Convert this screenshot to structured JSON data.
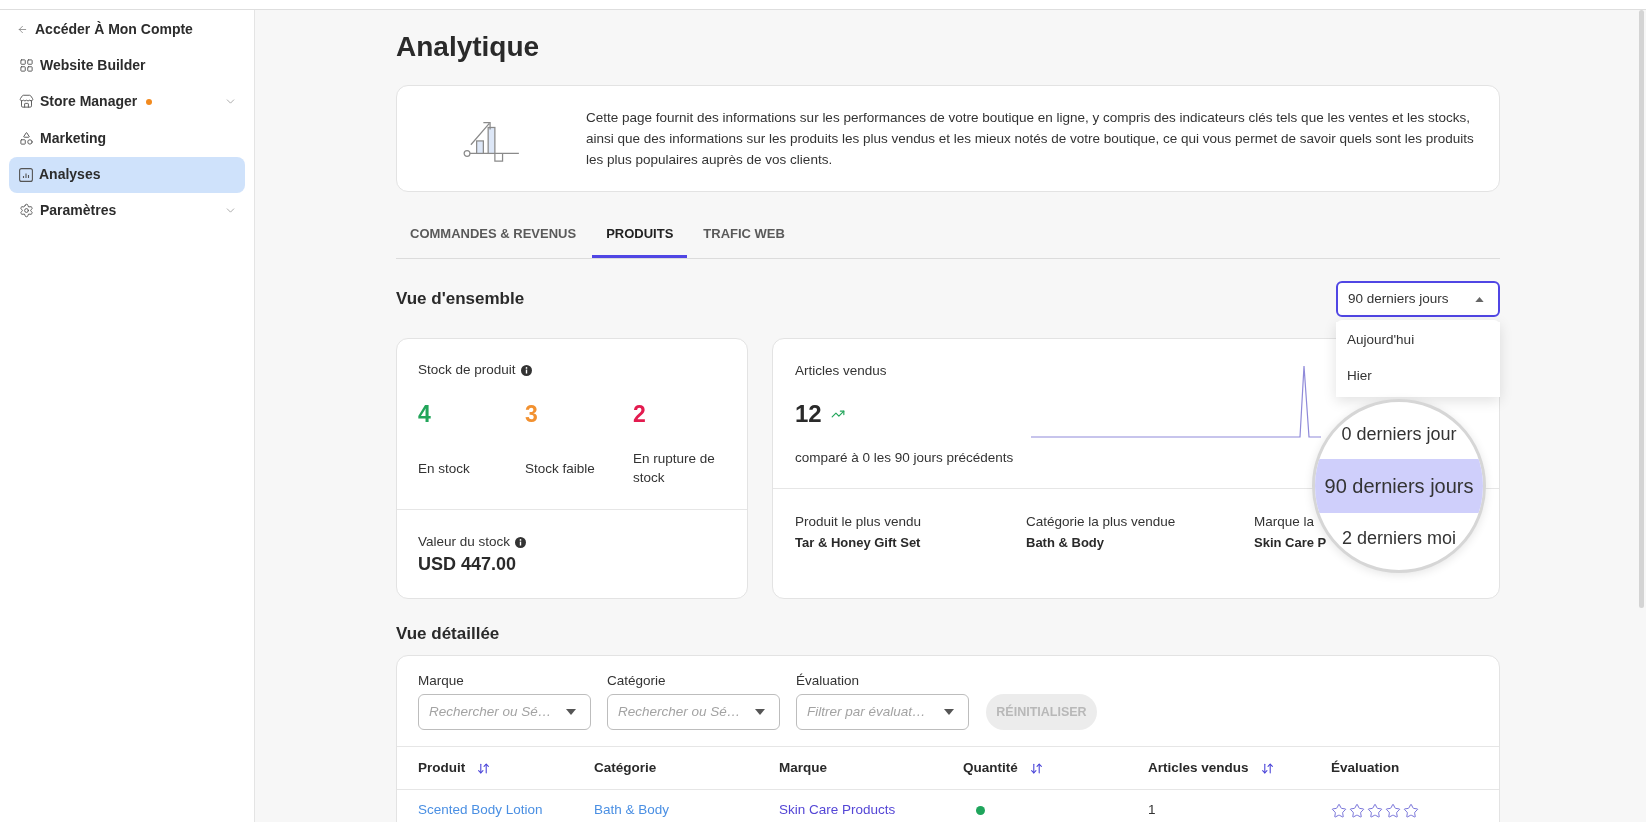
{
  "sidebar": {
    "back_link": "Accéder À Mon Compte",
    "items": [
      {
        "label": "Website Builder",
        "selected": false,
        "submenu": false,
        "dot": false
      },
      {
        "label": "Store Manager",
        "selected": false,
        "submenu": true,
        "dot": true
      },
      {
        "label": "Marketing",
        "selected": false,
        "submenu": false,
        "dot": false
      },
      {
        "label": "Analyses",
        "selected": true,
        "submenu": false,
        "dot": false
      },
      {
        "label": "Paramètres",
        "selected": false,
        "submenu": true,
        "dot": false
      }
    ]
  },
  "page": {
    "title": "Analytique",
    "intro": "Cette page fournit des informations sur les performances de votre boutique en ligne, y compris des indicateurs clés tels que les ventes et les stocks, ainsi que des informations sur les produits les plus vendus et les mieux notés de votre boutique, ce qui vous permet de savoir quels sont les produits les plus populaires auprès de vos clients."
  },
  "tabs": [
    {
      "label": "COMMANDES & REVENUS",
      "selected": false
    },
    {
      "label": "PRODUITS",
      "selected": true
    },
    {
      "label": "TRAFIC WEB",
      "selected": false
    }
  ],
  "overview": {
    "title": "Vue d'ensemble",
    "period_select": {
      "value": "90 derniers jours",
      "expanded": true,
      "options": [
        {
          "label": "Aujourd'hui",
          "selected": false
        },
        {
          "label": "Hier",
          "selected": false
        }
      ]
    },
    "magnifier": {
      "lines": [
        {
          "label": "0 derniers jour",
          "selected": false
        },
        {
          "label": "90 derniers jours",
          "selected": true
        },
        {
          "label": "2 derniers moi",
          "selected": false
        }
      ]
    },
    "stock_card": {
      "title": "Stock de produit",
      "metrics": [
        {
          "value": "4",
          "label": "En stock",
          "color": "#22a55a"
        },
        {
          "value": "3",
          "label": "Stock faible",
          "color": "#f29130"
        },
        {
          "value": "2",
          "label": "En rupture de stock",
          "color": "#e31b4f"
        }
      ],
      "value_label": "Valeur du stock",
      "value": "USD 447.00"
    },
    "sales_card": {
      "title": "Articles vendus",
      "value": "12",
      "comparison": "comparé à 0 les 90 jours précédents",
      "stats": [
        {
          "label": "Produit le plus vendu",
          "value": "Tar & Honey Gift Set"
        },
        {
          "label": "Catégorie la plus vendue",
          "value": "Bath & Body"
        },
        {
          "label": "Marque la",
          "value": "Skin Care P"
        }
      ]
    }
  },
  "detail": {
    "title": "Vue détaillée",
    "filters": [
      {
        "label": "Marque",
        "placeholder": "Rechercher ou Sé…"
      },
      {
        "label": "Catégorie",
        "placeholder": "Rechercher ou Sé…"
      },
      {
        "label": "Évaluation",
        "placeholder": "Filtrer par évaluat…"
      }
    ],
    "reset_button": {
      "label": "RÉINITIALISER",
      "disabled": true
    },
    "table": {
      "columns": [
        {
          "label": "Produit",
          "sortable": true
        },
        {
          "label": "Catégorie",
          "sortable": false
        },
        {
          "label": "Marque",
          "sortable": false
        },
        {
          "label": "Quantité",
          "sortable": true
        },
        {
          "label": "Articles vendus",
          "sortable": true
        },
        {
          "label": "Évaluation",
          "sortable": false
        }
      ],
      "rows": [
        {
          "product": "Scented Body Lotion",
          "category": "Bath & Body",
          "brand": "Skin Care Products",
          "quantity": {
            "color": "#1fa55c"
          },
          "sold": "1",
          "stars": 0
        }
      ]
    }
  }
}
